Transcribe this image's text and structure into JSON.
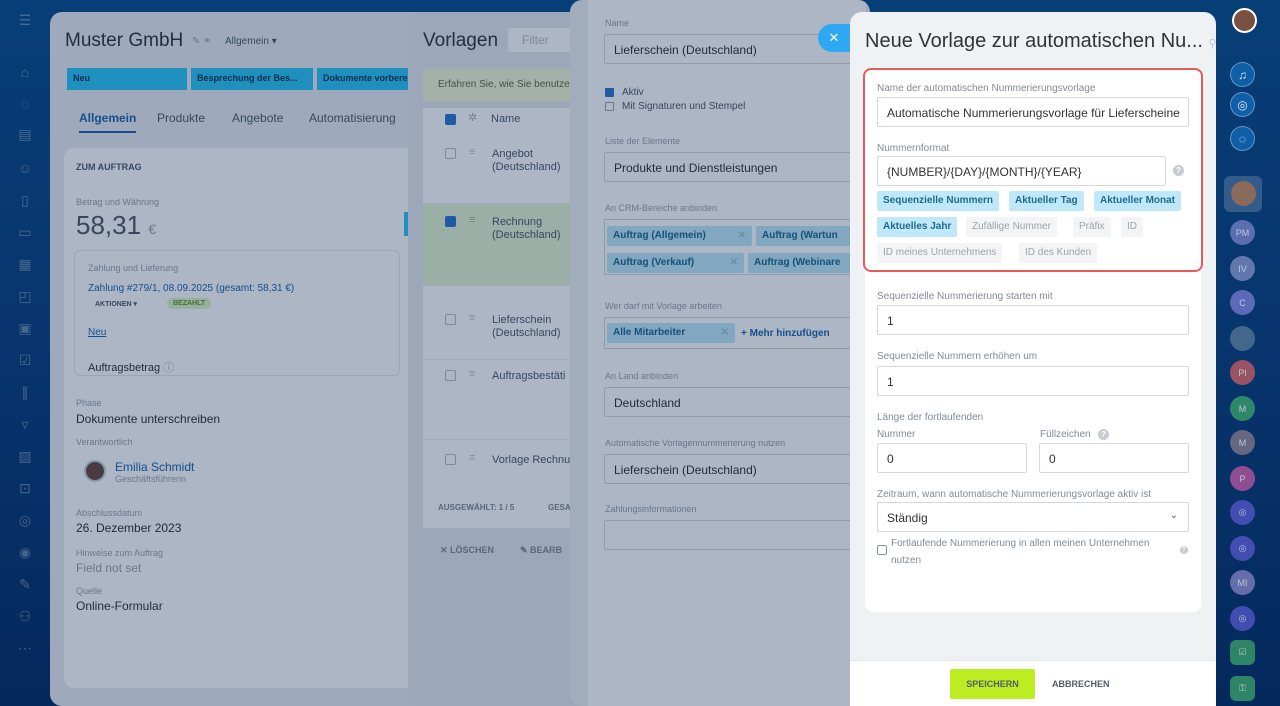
{
  "crm_panel": {
    "title": "Muster GmbH",
    "view_selector": "Allgemein",
    "stages": [
      "Neu",
      "Besprechung der Bes...",
      "Dokumente vorbere"
    ],
    "tabs": [
      "Allgemein",
      "Produkte",
      "Angebote",
      "Automatisierung"
    ],
    "section_heading": "ZUM AUFTRAG",
    "amount_label": "Betrag und Währung",
    "amount_value": "58,31",
    "currency": "€",
    "payment_heading": "Zahlung und Lieferung",
    "payment_link": "Zahlung #279/1, 08.09.2025 (gesamt: 58,31 €)",
    "actions_label": "AKTIONEN",
    "paid_badge": "BEZAHLT",
    "new_link": "Neu",
    "order_total_label": "Auftragsbetrag",
    "phase_label": "Phase",
    "phase_value": "Dokumente unterschreiben",
    "responsible_label": "Verantwortlich",
    "responsible_name": "Emilia Schmidt",
    "responsible_role": "Geschäftsführerin",
    "date_label": "Abschlussdatum",
    "date_value": "26. Dezember 2023",
    "field_label": "Hinweise zum Auftrag",
    "field_value": "Field not set",
    "source_label": "Quelle",
    "source_value": "Online-Formular"
  },
  "templates_panel": {
    "title": "Vorlagen",
    "filter_placeholder": "Filter",
    "info_banner": "Erfahren Sie, wie Sie benutze",
    "column_name": "Name",
    "rows": [
      {
        "name": "Angebot (Deutschland)",
        "checked": false
      },
      {
        "name": "Rechnung (Deutschland)",
        "checked": true
      },
      {
        "name": "Lieferschein (Deutschland)",
        "checked": false
      },
      {
        "name": "Auftragsbestätigung (Deutschland)",
        "checked": false
      },
      {
        "name": "Vorlage Rechnung (Deutschland)",
        "checked": false
      }
    ],
    "selected_label": "AUSGEWÄHLT: 1 / 5",
    "total_label": "GESA",
    "delete_button": "LÖSCHEN",
    "edit_button": "BEARB"
  },
  "template_settings": {
    "name_label": "Name",
    "name_value": "Lieferschein (Deutschland)",
    "active_label": "Aktiv",
    "signatures_label": "Mit Signaturen und Stempel",
    "elements_label": "Liste der Elemente",
    "elements_value": "Produkte und Dienstleistungen",
    "crm_label": "An CRM-Bereiche anbinden",
    "crm_tags": [
      "Auftrag (Allgemein)",
      "Auftrag (Wartun",
      "Auftrag (Verkauf)",
      "Auftrag (Webinare"
    ],
    "users_label": "Wer darf mit Vorlage arbeiten",
    "users_tag": "Alle Mitarbeiter",
    "add_more": "+ Mehr hinzufügen",
    "country_label": "An Land anbinden",
    "country_value": "Deutschland",
    "auto_label": "Automatische Vorlagennummerierung nutzen",
    "auto_value": "Lieferschein (Deutschland)",
    "payment_label": "Zahlungsinformationen"
  },
  "drawer": {
    "title": "Neue Vorlage zur automatischen Nu...",
    "name_label": "Name der automatischen Nummerierungsvorlage",
    "name_value": "Automatische Nummerierungsvorlage  für Lieferscheine",
    "format_label": "Nummernformat",
    "format_value": "{NUMBER}/{DAY}/{MONTH}/{YEAR}",
    "tokens": [
      {
        "label": "Sequenzielle Nummern",
        "active": true
      },
      {
        "label": "Aktueller Tag",
        "active": true
      },
      {
        "label": "Aktueller Monat",
        "active": true
      },
      {
        "label": "Aktuelles Jahr",
        "active": true
      },
      {
        "label": "Zufällige Nummer",
        "active": false
      },
      {
        "label": "Präfix",
        "active": false
      },
      {
        "label": "ID",
        "active": false
      },
      {
        "label": "ID meines Unternehmens",
        "active": false
      },
      {
        "label": "ID des Kunden",
        "active": false
      }
    ],
    "start_label": "Sequenzielle Nummerierung starten mit",
    "start_value": "1",
    "step_label": "Sequenzielle Nummern erhöhen um",
    "step_value": "1",
    "length_label_1": "Länge der fortlaufenden",
    "length_label_2": "Nummer",
    "length_value": "0",
    "pad_label": "Füllzeichen",
    "pad_value": "0",
    "period_label": "Zeitraum, wann automatische Nummerierungsvorlage aktiv ist",
    "period_value": "Ständig",
    "shared_label_1": "Fortlaufende Nummerierung in allen meinen Unternehmen",
    "shared_label_2": "nutzen",
    "save_button": "SPEICHERN",
    "cancel_button": "ABBRECHEN"
  },
  "right_sidebar": {
    "avatars": [
      "PM",
      "IV",
      "C",
      "PI",
      "M",
      "M",
      "P",
      "MI"
    ]
  },
  "colors": {
    "accent_blue": "#2fc6f6",
    "save_green": "#bbed21",
    "highlight_red": "#e85a55",
    "token_active_bg": "#bfe9fb"
  }
}
